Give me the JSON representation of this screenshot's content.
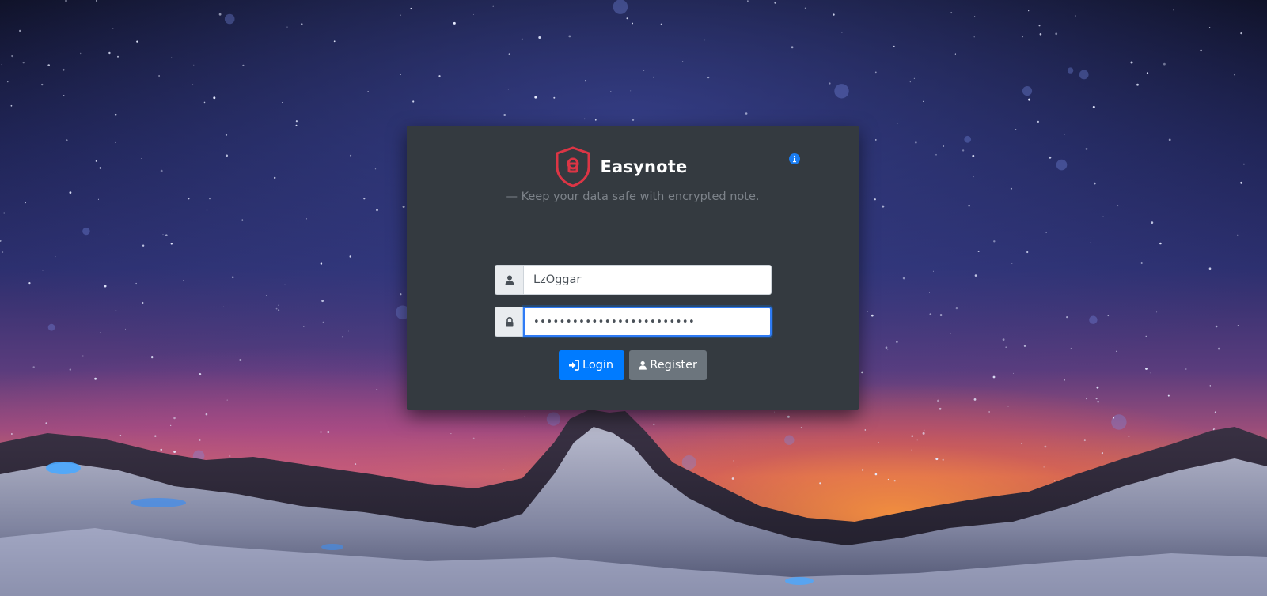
{
  "app": {
    "title": "Easynote",
    "tagline": "— Keep your data safe with encrypted note.",
    "logo_icon": "shield-lock-icon",
    "info_icon": "info-circle-icon"
  },
  "login_form": {
    "username": {
      "value": "LzOggar",
      "icon": "user-icon"
    },
    "password": {
      "value": "•••••••••••••••••••••••••",
      "icon": "lock-icon"
    },
    "login_button": {
      "label": "Login",
      "icon": "sign-in-icon"
    },
    "register_button": {
      "label": "Register",
      "icon": "user-icon"
    }
  },
  "colors": {
    "card_bg": "#343a40",
    "primary": "#007bff",
    "secondary": "#6c757d",
    "logo_red": "#dc3545",
    "info_blue": "#1a7cf0"
  }
}
